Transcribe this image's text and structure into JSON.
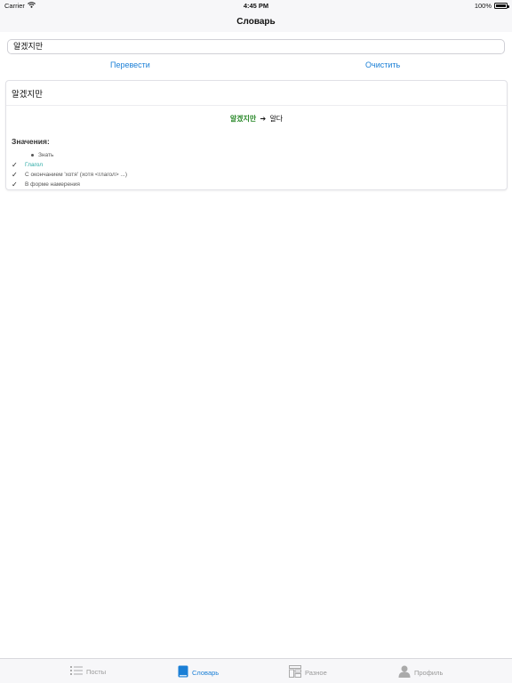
{
  "status": {
    "carrier": "Carrier",
    "time": "4:45 PM",
    "battery": "100%"
  },
  "nav": {
    "title": "Словарь"
  },
  "search": {
    "value": "알겠지만"
  },
  "actions": {
    "translate": "Перевести",
    "clear": "Очистить"
  },
  "card": {
    "word": "알겠지만",
    "conversion": {
      "from": "알겠지만",
      "arrow": "➔",
      "to": "알다"
    },
    "meanings_title": "Значения:",
    "meanings": [
      "Знать",
      "Глагол",
      "С окончанием 'хотя' (хотя <глагол> ...)",
      "В форме намерения"
    ]
  },
  "tabs": [
    {
      "label": "Посты",
      "icon": "list-icon"
    },
    {
      "label": "Словарь",
      "icon": "book-icon"
    },
    {
      "label": "Разное",
      "icon": "misc-icon"
    },
    {
      "label": "Профиль",
      "icon": "profile-icon"
    }
  ],
  "colors": {
    "accent": "#1a7fd6",
    "conversion_word": "#2c8a2c",
    "verb_tag": "#2aa9a4"
  }
}
